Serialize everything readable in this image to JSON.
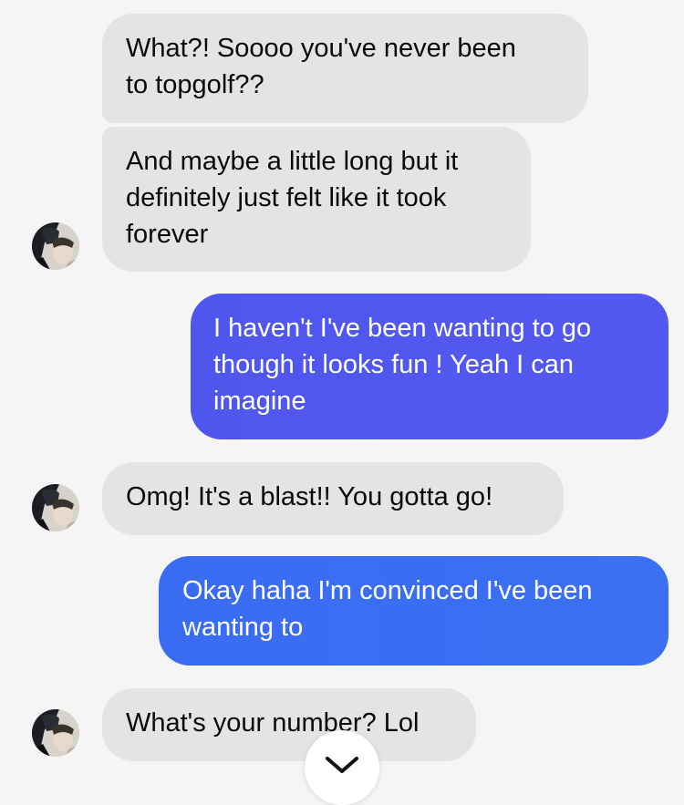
{
  "colors": {
    "background": "#f5f5f6",
    "incoming_bubble": "#e4e4e6",
    "outgoing_bubble_1": "#5057ef",
    "outgoing_bubble_2": "#3b6ef3",
    "scroll_button": "#ffffff"
  },
  "messages": [
    {
      "direction": "incoming",
      "lines": [
        "What?! Soooo you've never been",
        "to topgolf??"
      ]
    },
    {
      "direction": "incoming",
      "lines": [
        "And maybe a little long but it",
        "definitely just felt like it took",
        "forever"
      ]
    },
    {
      "direction": "outgoing",
      "lines": [
        "I haven't I've been wanting to go",
        "though it looks fun ! Yeah I can",
        "imagine"
      ]
    },
    {
      "direction": "incoming",
      "lines": [
        "Omg! It's a blast!! You gotta go!"
      ]
    },
    {
      "direction": "outgoing",
      "lines": [
        "Okay haha I'm convinced I've been",
        "wanting to"
      ]
    },
    {
      "direction": "incoming",
      "lines": [
        "What's your number? Lol"
      ]
    }
  ],
  "icons": {
    "avatar": "contact-avatar-photo",
    "scroll_down": "chevron-down-icon"
  }
}
